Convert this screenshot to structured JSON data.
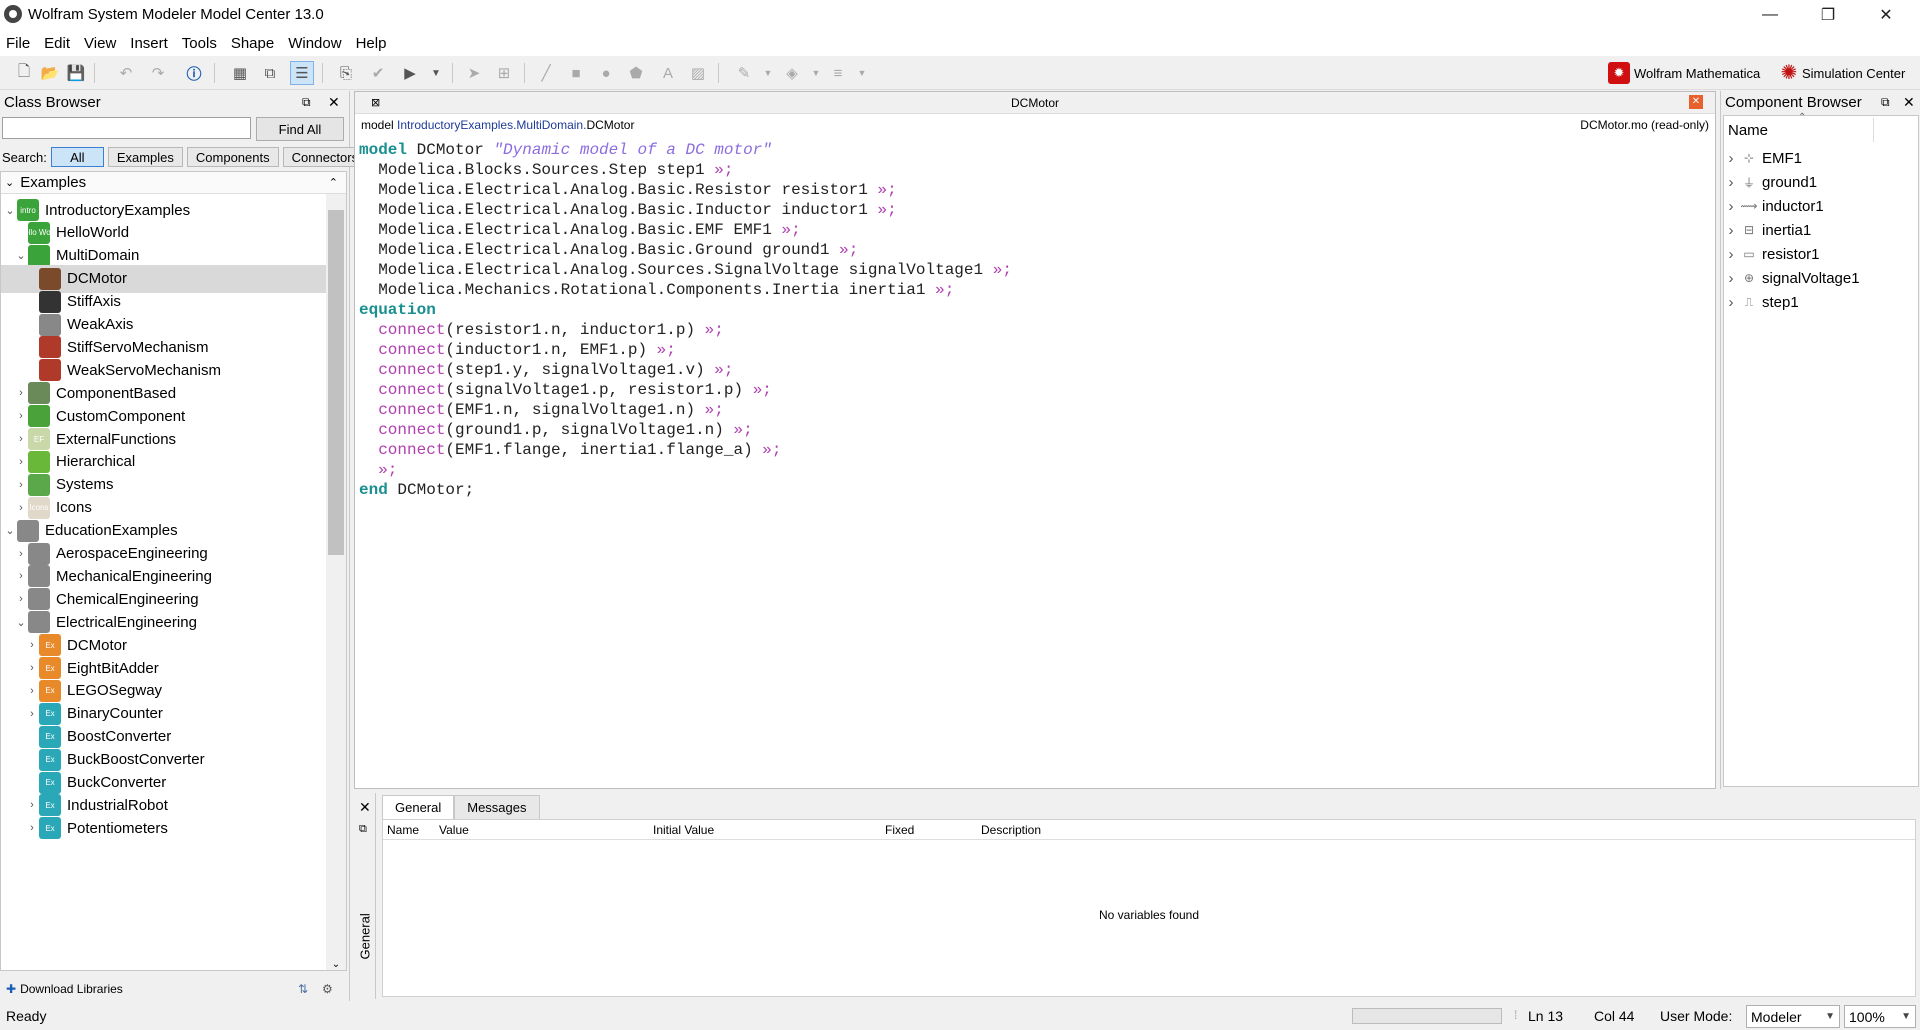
{
  "window": {
    "title": "Wolfram System Modeler Model Center 13.0",
    "minimize": "—",
    "restore": "❐",
    "close": "✕"
  },
  "menu": [
    "File",
    "Edit",
    "View",
    "Insert",
    "Tools",
    "Shape",
    "Window",
    "Help"
  ],
  "toolbar": {
    "mathematica_label": "Wolfram Mathematica",
    "simulation_label": "Simulation Center"
  },
  "class_browser": {
    "title": "Class Browser",
    "search_value": "",
    "find_all": "Find All",
    "search_label": "Search:",
    "filters": [
      "All",
      "Examples",
      "Components",
      "Connectors"
    ],
    "root": "Examples",
    "tree": [
      {
        "label": "IntroductoryExamples",
        "icon": "intro"
      },
      {
        "label": "HelloWorld",
        "icon": "Hello World"
      },
      {
        "label": "MultiDomain",
        "icon": ""
      },
      {
        "label": "DCMotor",
        "icon": ""
      },
      {
        "label": "StiffAxis",
        "icon": ""
      },
      {
        "label": "WeakAxis",
        "icon": ""
      },
      {
        "label": "StiffServoMechanism",
        "icon": ""
      },
      {
        "label": "WeakServoMechanism",
        "icon": ""
      },
      {
        "label": "ComponentBased",
        "icon": ""
      },
      {
        "label": "CustomComponent",
        "icon": ""
      },
      {
        "label": "ExternalFunctions",
        "icon": "EF"
      },
      {
        "label": "Hierarchical",
        "icon": ""
      },
      {
        "label": "Systems",
        "icon": ""
      },
      {
        "label": "Icons",
        "icon": "Icons"
      },
      {
        "label": "EducationExamples",
        "icon": ""
      },
      {
        "label": "AerospaceEngineering",
        "icon": ""
      },
      {
        "label": "MechanicalEngineering",
        "icon": ""
      },
      {
        "label": "ChemicalEngineering",
        "icon": ""
      },
      {
        "label": "ElectricalEngineering",
        "icon": ""
      },
      {
        "label": "DCMotor",
        "icon": "Ex"
      },
      {
        "label": "EightBitAdder",
        "icon": "Ex"
      },
      {
        "label": "LEGOSegway",
        "icon": "Ex"
      },
      {
        "label": "BinaryCounter",
        "icon": "Ex"
      },
      {
        "label": "BoostConverter",
        "icon": "Ex"
      },
      {
        "label": "BuckBoostConverter",
        "icon": "Ex"
      },
      {
        "label": "BuckConverter",
        "icon": "Ex"
      },
      {
        "label": "IndustrialRobot",
        "icon": "Ex"
      },
      {
        "label": "Potentiometers",
        "icon": "Ex"
      }
    ],
    "download_libraries": "Download Libraries"
  },
  "editor": {
    "tab_title": "DCMotor",
    "path_prefix": "model",
    "path_link": "IntroductoryExamples.MultiDomain.",
    "path_name": "DCMotor",
    "file_info": "DCMotor.mo (read-only)"
  },
  "code": {
    "model_kw": "model",
    "model_name": " DCMotor ",
    "model_desc": "\"Dynamic model of a DC motor\"",
    "decls": [
      "Modelica.Blocks.Sources.Step step1",
      "Modelica.Electrical.Analog.Basic.Resistor resistor1",
      "Modelica.Electrical.Analog.Basic.Inductor inductor1",
      "Modelica.Electrical.Analog.Basic.EMF EMF1",
      "Modelica.Electrical.Analog.Basic.Ground ground1",
      "Modelica.Electrical.Analog.Sources.SignalVoltage signalVoltage1",
      "Modelica.Mechanics.Rotational.Components.Inertia inertia1"
    ],
    "equation_kw": "equation",
    "connect_kw": "connect",
    "connects": [
      "(resistor1.n, inductor1.p)",
      "(inductor1.n, EMF1.p)",
      "(step1.y, signalVoltage1.v)",
      "(signalVoltage1.p, resistor1.p)",
      "(EMF1.n, signalVoltage1.n)",
      "(ground1.p, signalVoltage1.n)",
      "(EMF1.flange, inertia1.flange_a)"
    ],
    "fold_marker": "»;",
    "end_kw": "end",
    "end_name": " DCMotor;"
  },
  "component_browser": {
    "title": "Component Browser",
    "column": "Name",
    "items": [
      "EMF1",
      "ground1",
      "inductor1",
      "inertia1",
      "resistor1",
      "signalVoltage1",
      "step1"
    ]
  },
  "bottom_panel": {
    "tabs": [
      "General",
      "Messages"
    ],
    "side_label": "General",
    "columns": [
      "Name",
      "Value",
      "Initial Value",
      "Fixed",
      "Description"
    ],
    "empty_message": "No variables found"
  },
  "status": {
    "ready": "Ready",
    "line": "Ln 13",
    "col": "Col 44",
    "user_mode_label": "User Mode:",
    "user_mode": "Modeler",
    "zoom": "100%"
  }
}
